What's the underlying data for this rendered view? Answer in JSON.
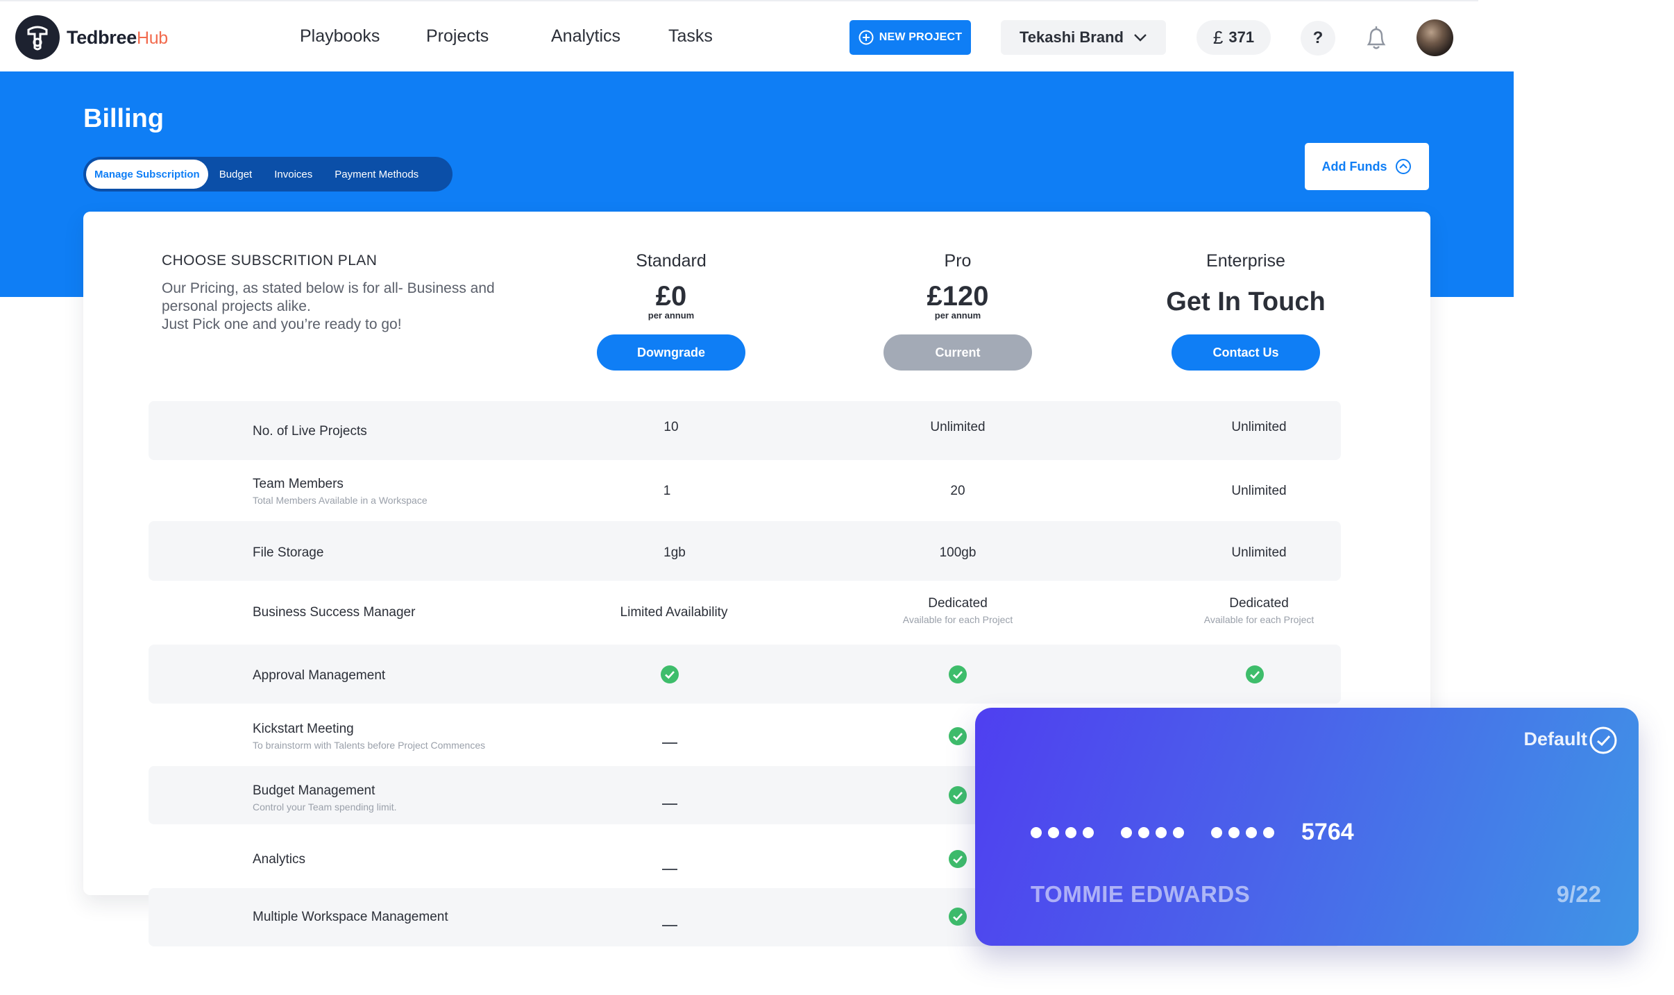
{
  "brand": {
    "name": "Tedbree",
    "suffix": "Hub"
  },
  "nav": {
    "items": [
      "Playbooks",
      "Projects",
      "Analytics",
      "Tasks"
    ]
  },
  "header": {
    "new_project_label": "NEW PROJECT",
    "brand_select": "Tekashi Brand",
    "balance_currency": "£",
    "balance_value": "371",
    "help_label": "?"
  },
  "billing": {
    "title": "Billing",
    "tabs": [
      "Manage Subscription",
      "Budget",
      "Invoices",
      "Payment Methods"
    ],
    "active_tab": "Manage Subscription",
    "add_funds_label": "Add Funds"
  },
  "plans_section": {
    "heading": "CHOOSE SUBSCRITION PLAN",
    "description": [
      "Our Pricing, as stated below is for all- Business and",
      "personal projects alike.",
      "Just Pick one and you’re ready to go!"
    ]
  },
  "plans": [
    {
      "name": "Standard",
      "price": "£0",
      "period": "per annum",
      "button": "Downgrade",
      "button_color": "#0f7ef5"
    },
    {
      "name": "Pro",
      "price": "£120",
      "period": "per annum",
      "button": "Current",
      "button_color": "#a3aab6"
    },
    {
      "name": "Enterprise",
      "cta": "Get In Touch",
      "button": "Contact Us",
      "button_color": "#0f7ef5"
    }
  ],
  "features": [
    {
      "name": "No. of Live Projects",
      "sub": "",
      "values": [
        "10",
        "Unlimited",
        "Unlimited"
      ]
    },
    {
      "name": "Team Members",
      "sub": "Total Members Available in a Workspace",
      "values": [
        "1",
        "20",
        "Unlimited"
      ]
    },
    {
      "name": "File Storage",
      "sub": "",
      "values": [
        "1gb",
        "100gb",
        "Unlimited"
      ]
    },
    {
      "name": "Business Success Manager",
      "sub": "",
      "values": [
        "Limited Availability",
        "Dedicated",
        "Dedicated"
      ],
      "value_subs": [
        "",
        "Available for each Project",
        "Available for each Project"
      ]
    },
    {
      "name": "Approval Management",
      "sub": "",
      "values": [
        "check",
        "check",
        "check"
      ]
    },
    {
      "name": "Kickstart Meeting",
      "sub": "To brainstorm with Talents before Project Commences",
      "values": [
        "dash",
        "check",
        "hidden"
      ]
    },
    {
      "name": "Budget Management",
      "sub": "Control your Team spending limit.",
      "values": [
        "dash",
        "check",
        "hidden"
      ]
    },
    {
      "name": "Analytics",
      "sub": "",
      "values": [
        "dash",
        "check",
        "hidden"
      ]
    },
    {
      "name": "Multiple Workspace Management",
      "sub": "",
      "values": [
        "dash",
        "check",
        "hidden"
      ]
    }
  ],
  "payment_card": {
    "badge": "Default",
    "last4": "5764",
    "holder": "TOMMIE EDWARDS",
    "expiry": "9/22"
  },
  "colors": {
    "primary": "#0f7ef5",
    "check": "#3ebd6b",
    "card_from": "#4f3ff0",
    "card_to": "#3f95e6"
  }
}
